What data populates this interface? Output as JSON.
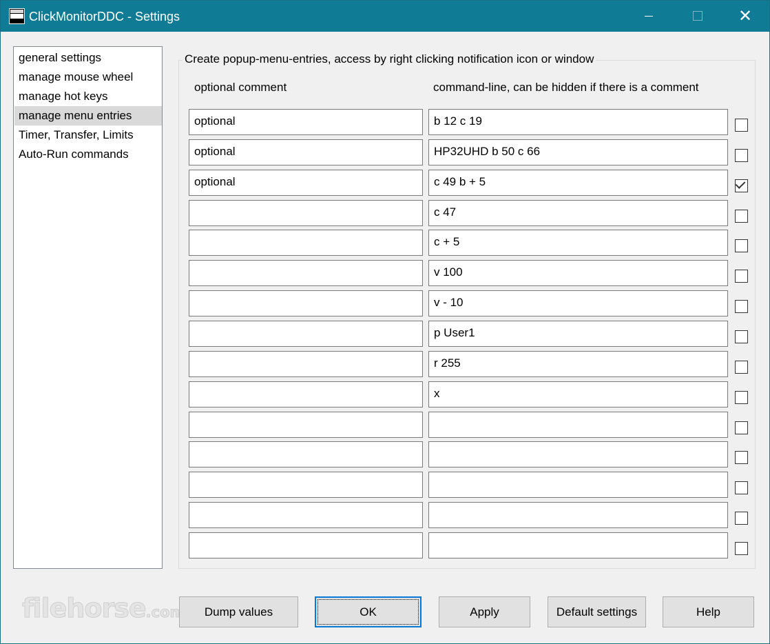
{
  "window": {
    "title": "ClickMonitorDDC - Settings",
    "controls": {
      "minimize": "minimize-icon",
      "maximize": "maximize-icon",
      "close": "✕"
    }
  },
  "sidebar": {
    "items": [
      {
        "label": "general settings",
        "selected": false
      },
      {
        "label": "manage mouse wheel",
        "selected": false
      },
      {
        "label": "manage hot keys",
        "selected": false
      },
      {
        "label": "manage menu entries",
        "selected": true
      },
      {
        "label": "Timer, Transfer, Limits",
        "selected": false
      },
      {
        "label": "Auto-Run commands",
        "selected": false
      }
    ]
  },
  "menu_entries": {
    "group_title": "Create popup-menu-entries, access by right clicking notification icon or window",
    "column_comment": "optional comment",
    "column_command": "command-line, can be hidden if there is a comment",
    "rows": [
      {
        "comment": "optional",
        "command": "b 12  c 19",
        "hidden": false
      },
      {
        "comment": "optional",
        "command": "HP32UHD   b 50  c 66",
        "hidden": false
      },
      {
        "comment": "optional",
        "command": "c 49  b + 5",
        "hidden": true
      },
      {
        "comment": "",
        "command": "c 47",
        "hidden": false
      },
      {
        "comment": "",
        "command": "c + 5",
        "hidden": false
      },
      {
        "comment": "",
        "command": "v 100",
        "hidden": false
      },
      {
        "comment": "",
        "command": "v - 10",
        "hidden": false
      },
      {
        "comment": "",
        "command": "p User1",
        "hidden": false
      },
      {
        "comment": "",
        "command": "r 255",
        "hidden": false
      },
      {
        "comment": "",
        "command": "x",
        "hidden": false
      },
      {
        "comment": "",
        "command": "",
        "hidden": false
      },
      {
        "comment": "",
        "command": "",
        "hidden": false
      },
      {
        "comment": "",
        "command": "",
        "hidden": false
      },
      {
        "comment": "",
        "command": "",
        "hidden": false
      },
      {
        "comment": "",
        "command": "",
        "hidden": false
      }
    ]
  },
  "buttons": {
    "dump": "Dump values",
    "ok": "OK",
    "apply": "Apply",
    "default": "Default settings",
    "help": "Help"
  },
  "watermark": {
    "name": "filehorse",
    "domain": ".com"
  },
  "colors": {
    "titlebar": "#0f7b95",
    "selection": "#d9d9d9",
    "focus_border": "#0078d7"
  }
}
